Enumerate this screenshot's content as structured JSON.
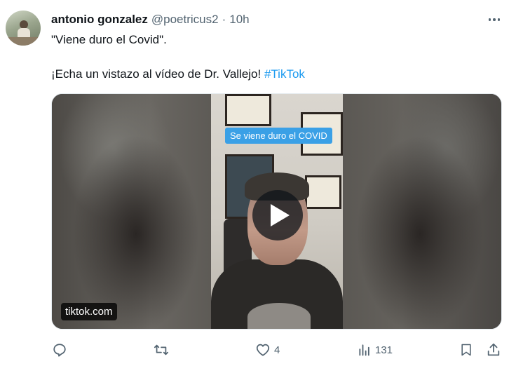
{
  "tweet": {
    "author_name": "antonio gonzalez",
    "handle": "@poetricus2",
    "separator": "·",
    "time": "10h",
    "text_line1": "\"Viene duro el Covid\".",
    "text_line2_prefix": "¡Echa un vistazo al vídeo de Dr. Vallejo! ",
    "hashtag": "#TikTok"
  },
  "media": {
    "caption": "Se viene duro el COVID",
    "domain": "tiktok.com",
    "play_icon": "play-icon"
  },
  "actions": {
    "reply_icon": "reply-icon",
    "retweet_icon": "retweet-icon",
    "like_icon": "heart-icon",
    "like_count": "4",
    "views_icon": "views-icon",
    "views_count": "131",
    "bookmark_icon": "bookmark-icon",
    "share_icon": "share-icon"
  },
  "colors": {
    "text": "#0f1419",
    "secondary": "#536471",
    "accent": "#1d9bf0",
    "caption_bg": "#3aa0e6"
  }
}
